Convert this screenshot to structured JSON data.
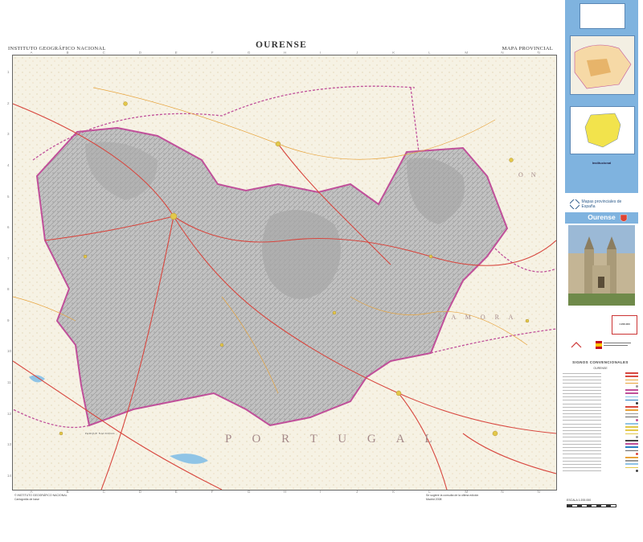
{
  "header": {
    "agency": "INSTITUTO GEOGRÁFICO NACIONAL",
    "title": "OURENSE",
    "map_type": "MAPA PROVINCIAL"
  },
  "map": {
    "labels": {
      "portugal": "P O R T U G A L",
      "zamora": "Z A M O R A",
      "leon": "O N",
      "parque": "PARQUE NACIONAL"
    },
    "grid_top": [
      "A",
      "B",
      "C",
      "D",
      "E",
      "F",
      "G",
      "H",
      "I",
      "J",
      "K",
      "L",
      "M",
      "N",
      "Ñ"
    ],
    "grid_side": [
      "1",
      "2",
      "3",
      "4",
      "5",
      "6",
      "7",
      "8",
      "9",
      "10",
      "11",
      "12",
      "13",
      "14"
    ],
    "colors": {
      "land": "#f6f2e4",
      "province_relief": "#b5b5b5",
      "border": "#c0509a",
      "road": "#d8473f",
      "water": "#8fc4e6"
    }
  },
  "footer": {
    "left_lines": [
      "© INSTITUTO GEOGRÁFICO NACIONAL",
      "Cartografía de base"
    ],
    "mid_lines": [
      "Se sugiere la consulta de la última edición",
      "Madrid 2008"
    ]
  },
  "legend": {
    "title": "SIGNOS CONVENCIONALES",
    "subtitle": "OURENSE",
    "scale_label": "ESCALA 1:200.000"
  },
  "cover": {
    "province_name": "Ourense",
    "series_label": "Mapas provinciales de España",
    "inset_label_1": "Institucional",
    "scale_stamp": "1:200.000"
  }
}
